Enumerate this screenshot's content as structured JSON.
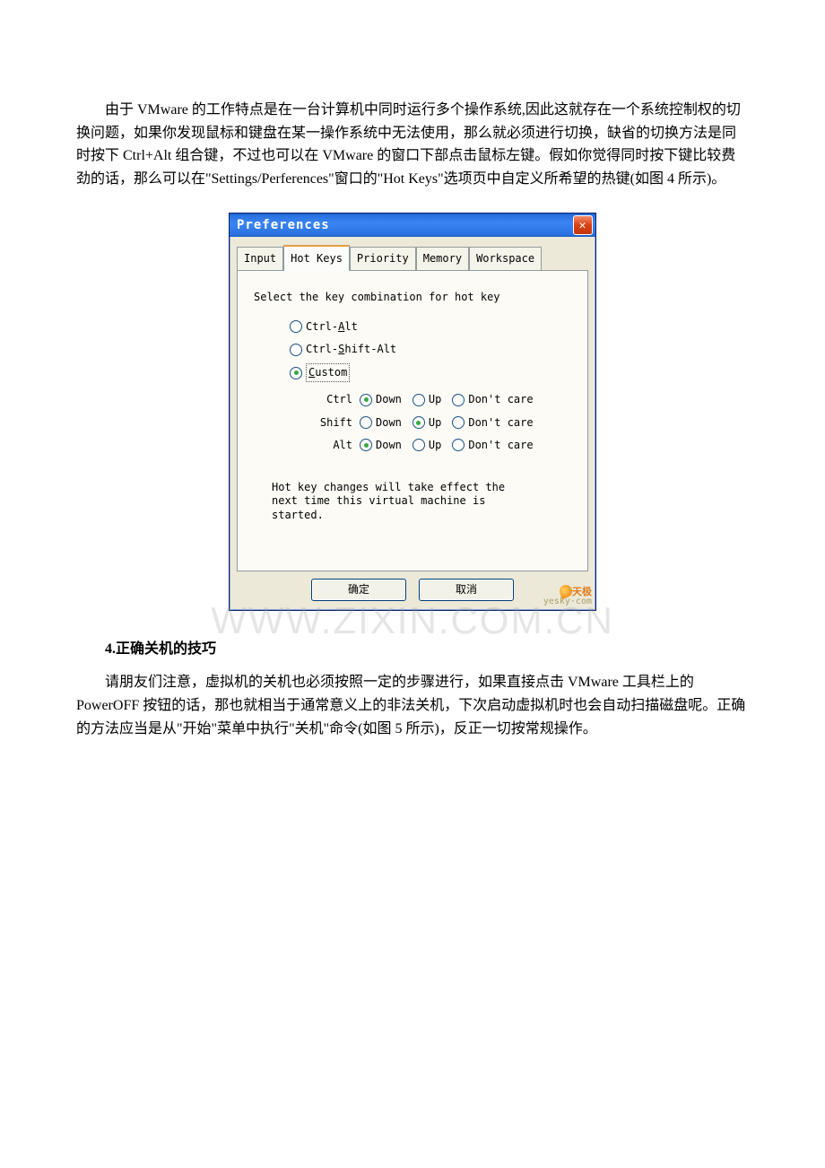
{
  "para1": "由于 VMware 的工作特点是在一台计算机中同时运行多个操作系统,因此这就存在一个系统控制权的切换问题，如果你发现鼠标和键盘在某一操作系统中无法使用，那么就必须进行切换，缺省的切换方法是同时按下 Ctrl+Alt 组合键，不过也可以在 VMware 的窗口下部点击鼠标左键。假如你觉得同时按下键比较费劲的话，那么可以在\"Settings/Perferences\"窗口的\"Hot Keys\"选项页中自定义所希望的热键(如图 4 所示)。",
  "section_heading": "4.正确关机的技巧",
  "para2": "请朋友们注意，虚拟机的关机也必须按照一定的步骤进行，如果直接点击 VMware 工具栏上的 PowerOFF 按钮的话，那也就相当于通常意义上的非法关机，下次启动虚拟机时也会自动扫描磁盘呢。正确的方法应当是从\"开始\"菜单中执行\"关机\"命令(如图 5 所示)，反正一切按常规操作。",
  "dialog": {
    "title": "Preferences",
    "tabs": [
      "Input",
      "Hot Keys",
      "Priority",
      "Memory",
      "Workspace"
    ],
    "active_tab_index": 1,
    "heading": "Select the key combination for hot key",
    "radios": {
      "opt1_pre": "Ctrl-",
      "opt1_key": "A",
      "opt1_post": "lt",
      "opt2_pre": "Ctrl-",
      "opt2_key": "S",
      "opt2_post": "hift-Alt",
      "opt3_key": "C",
      "opt3_post": "ustom"
    },
    "key_rows": [
      {
        "name": "Ctrl",
        "sel": "Down"
      },
      {
        "name": "Shift",
        "sel": "Up"
      },
      {
        "name": "Alt",
        "sel": "Down"
      }
    ],
    "options": {
      "down": "Down",
      "up": "Up",
      "dont": "Don't care"
    },
    "note": "Hot key changes will take effect the next time this virtual machine is started.",
    "ok": "确定",
    "cancel": "取消"
  },
  "watermark": "WWW.ZIXIN.COM.CN",
  "logo": {
    "brand": "天极",
    "url": "yesky·com"
  }
}
